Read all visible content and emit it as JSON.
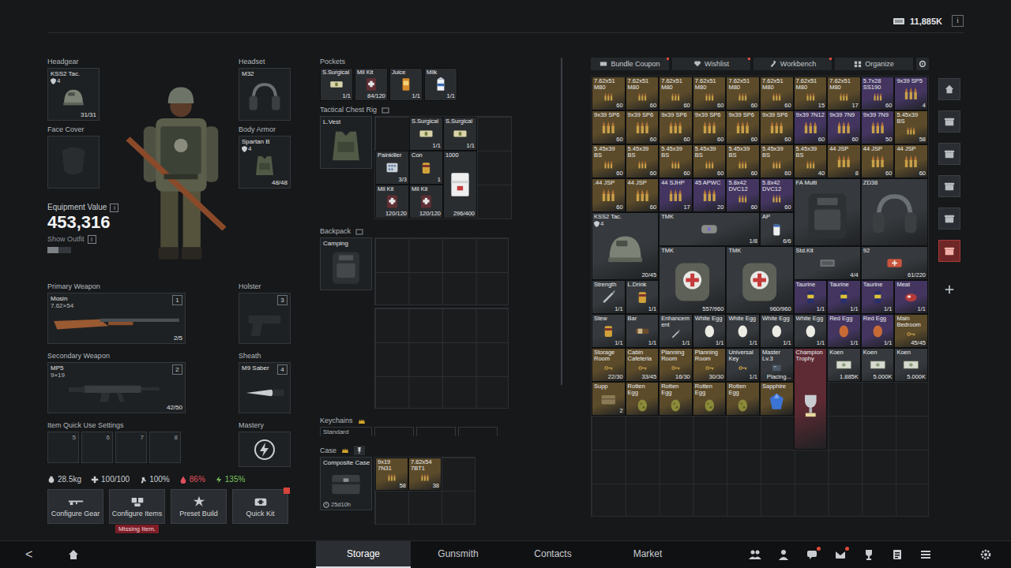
{
  "topbar": {
    "currency": "11,885K",
    "info": "i"
  },
  "loadout": {
    "headgear": {
      "label": "Headgear",
      "item": "KSS2 Tac.",
      "tier": "4",
      "durability": "31/31"
    },
    "face_cover": {
      "label": "Face Cover"
    },
    "headset": {
      "label": "Headset",
      "item": "M32"
    },
    "body_armor": {
      "label": "Body Armor",
      "item": "Spartan B",
      "tier": "4",
      "durability": "48/48"
    },
    "equipment_value": {
      "label": "Equipment Value",
      "info": "i",
      "value": "453,316"
    },
    "show_outfit": {
      "label": "Show Outfit",
      "info": "i",
      "on": false
    },
    "primary": {
      "label": "Primary Weapon",
      "item": "Mosin",
      "caliber": "7.62×54",
      "ammo": "2/5",
      "key": "1"
    },
    "holster": {
      "label": "Holster",
      "key": "3"
    },
    "secondary": {
      "label": "Secondary Weapon",
      "item": "MP5",
      "caliber": "9×19",
      "ammo": "42/50",
      "key": "2"
    },
    "sheath": {
      "label": "Sheath",
      "item": "M9 Saber",
      "key": "4"
    },
    "quick_use": {
      "label": "Item Quick Use Settings",
      "keys": [
        "5",
        "6",
        "7",
        "8"
      ]
    },
    "mastery": {
      "label": "Mastery"
    }
  },
  "stats": [
    {
      "kind": "weight",
      "value": "28.5kg",
      "color": "#c9cdd1"
    },
    {
      "kind": "health",
      "value": "100/100",
      "color": "#c9cdd1"
    },
    {
      "kind": "stamina",
      "value": "100%",
      "color": "#c9cdd1"
    },
    {
      "kind": "hydration",
      "value": "86%",
      "color": "#e0505a"
    },
    {
      "kind": "energy",
      "value": "135%",
      "color": "#7cc45a"
    }
  ],
  "actions": [
    {
      "label": "Configure Gear",
      "kind": "rifle",
      "alert": false
    },
    {
      "label": "Configure Items",
      "kind": "items",
      "alert": false,
      "warning": "Missing Item."
    },
    {
      "label": "Preset Build",
      "kind": "preset",
      "alert": false
    },
    {
      "label": "Quick Kit",
      "kind": "kit",
      "alert": true
    }
  ],
  "gear": {
    "pockets": {
      "label": "Pockets",
      "items": [
        {
          "name": "S.Surgical",
          "count": "1/1",
          "kind": "surgical"
        },
        {
          "name": "Mil Kit",
          "count": "84/120",
          "kind": "milkit"
        },
        {
          "name": "Juice",
          "count": "1/1",
          "kind": "juice"
        },
        {
          "name": "Milk",
          "count": "1/1",
          "kind": "milk"
        }
      ]
    },
    "rig": {
      "label": "Tactical Chest Rig",
      "container": "L.Vest",
      "items": [
        {
          "name": "S.Surgical",
          "count": "1/1",
          "kind": "surgical"
        },
        {
          "name": "S.Surgical",
          "count": "1/1",
          "kind": "surgical"
        },
        {
          "name": "Painkiller",
          "count": "3/3",
          "kind": "painkiller"
        },
        {
          "name": "Con",
          "count": "1",
          "kind": "can"
        },
        {
          "name": "1000",
          "count": "296/400",
          "kind": "roll"
        },
        {
          "name": "Mil Kit",
          "count": "120/120",
          "kind": "milkit"
        },
        {
          "name": "Mil Kit",
          "count": "120/120",
          "kind": "milkit"
        }
      ]
    },
    "backpack": {
      "label": "Backpack",
      "container": "Camping"
    },
    "keychains": {
      "label": "Keychains",
      "container": "Standard"
    },
    "case": {
      "label": "Case",
      "container": "Composite Case",
      "timer": "25d10h",
      "items": [
        {
          "name": "9x19 7N31",
          "count": "58",
          "kind": "ammo"
        },
        {
          "name": "7.62x54 7BT1",
          "count": "38",
          "kind": "ammo"
        }
      ]
    }
  },
  "storage": {
    "tabs": [
      {
        "label": "Bundle Coupon",
        "kind": "coupon",
        "alert": true
      },
      {
        "label": "Wishlist",
        "kind": "heart",
        "alert": true
      },
      {
        "label": "Workbench",
        "kind": "wrench",
        "alert": true
      },
      {
        "label": "Organize",
        "kind": "organize",
        "alert": false
      }
    ],
    "items": [
      {
        "name": "7.62x51 M80",
        "count": "60",
        "kind": "ammo",
        "color": "#5c4b2a"
      },
      {
        "name": "7.62x51 M80",
        "count": "60",
        "kind": "ammo",
        "color": "#5c4b2a"
      },
      {
        "name": "7.62x51 M80",
        "count": "60",
        "kind": "ammo",
        "color": "#5c4b2a"
      },
      {
        "name": "7.62x51 M80",
        "count": "60",
        "kind": "ammo",
        "color": "#5c4b2a"
      },
      {
        "name": "7.62x51 M80",
        "count": "60",
        "kind": "ammo",
        "color": "#5c4b2a"
      },
      {
        "name": "7.62x51 M80",
        "count": "60",
        "kind": "ammo",
        "color": "#5c4b2a"
      },
      {
        "name": "7.62x51 M80",
        "count": "15",
        "kind": "ammo",
        "color": "#5c4b2a"
      },
      {
        "name": "7.62x51 M80",
        "count": "17",
        "kind": "ammo",
        "color": "#5c4b2a"
      },
      {
        "name": "5.7x28 SS190",
        "count": "60",
        "kind": "ammo",
        "color": "#433560"
      },
      {
        "name": "9x39 SP5",
        "count": "4",
        "kind": "ammo",
        "color": "#433560"
      },
      {
        "name": "9x39 SP6",
        "count": "60",
        "kind": "ammo",
        "color": "#5c4b2a"
      },
      {
        "name": "9x39 SP6",
        "count": "60",
        "kind": "ammo",
        "color": "#5c4b2a"
      },
      {
        "name": "9x39 SP6",
        "count": "60",
        "kind": "ammo",
        "color": "#5c4b2a"
      },
      {
        "name": "9x39 SP6",
        "count": "60",
        "kind": "ammo",
        "color": "#5c4b2a"
      },
      {
        "name": "9x39 SP6",
        "count": "60",
        "kind": "ammo",
        "color": "#5c4b2a"
      },
      {
        "name": "9x39 SP6",
        "count": "60",
        "kind": "ammo",
        "color": "#5c4b2a"
      },
      {
        "name": "9x39 7N12",
        "count": "60",
        "kind": "ammo",
        "color": "#433560"
      },
      {
        "name": "9x39 7N9",
        "count": "60",
        "kind": "ammo",
        "color": "#433560"
      },
      {
        "name": "9x39 7N9",
        "count": "50",
        "kind": "ammo",
        "color": "#433560"
      },
      {
        "name": "5.45x39 BS",
        "count": "58",
        "kind": "ammo",
        "color": "#5c4b2a"
      },
      {
        "name": "5.45x39 BS",
        "count": "60",
        "kind": "ammo",
        "color": "#5c4b2a"
      },
      {
        "name": "5.45x39 BS",
        "count": "60",
        "kind": "ammo",
        "color": "#5c4b2a"
      },
      {
        "name": "5.45x39 BS",
        "count": "60",
        "kind": "ammo",
        "color": "#5c4b2a"
      },
      {
        "name": "5.45x39 BS",
        "count": "60",
        "kind": "ammo",
        "color": "#5c4b2a"
      },
      {
        "name": "5.45x39 BS",
        "count": "60",
        "kind": "ammo",
        "color": "#5c4b2a"
      },
      {
        "name": "5.45x39 BS",
        "count": "60",
        "kind": "ammo",
        "color": "#5c4b2a"
      },
      {
        "name": "5.45x39 BS",
        "count": "40",
        "kind": "ammo",
        "color": "#5c4b2a"
      },
      {
        "name": "44 JSP",
        "count": "8",
        "kind": "ammo",
        "color": "#5c4b2a"
      },
      {
        "name": "44 JSP",
        "count": "60",
        "kind": "ammo",
        "color": "#5c4b2a"
      },
      {
        "name": "44 JSP",
        "count": "60",
        "kind": "ammo",
        "color": "#5c4b2a"
      },
      {
        "name": ".44 JSP",
        "count": "60",
        "kind": "ammo",
        "color": "#5c4b2a"
      },
      {
        "name": "44 JSP",
        "count": "60",
        "kind": "ammo",
        "color": "#5c4b2a"
      },
      {
        "name": "44 SJHP",
        "count": "17",
        "kind": "ammo",
        "color": "#433560"
      },
      {
        "name": "45 APWC",
        "count": "20",
        "kind": "ammo",
        "color": "#433560"
      },
      {
        "name": "5.8x42 DVC12",
        "count": "60",
        "kind": "ammo",
        "color": "#433560"
      },
      {
        "name": "5.8x42 DVC12",
        "count": "60",
        "kind": "ammo",
        "color": "#433560"
      },
      {
        "name": "FA Multi",
        "kind": "bag",
        "color": "#363a3e"
      },
      {
        "name": "ZD38",
        "kind": "headset",
        "color": "#363a3e"
      },
      {
        "name": "KSS2 Tac.",
        "tier": "4",
        "count": "20/45",
        "kind": "helmet",
        "color": "#363a3e"
      },
      {
        "name": "TMK",
        "count": "1/8",
        "kind": "case",
        "color": "#363a3e"
      },
      {
        "name": "AP",
        "count": "6/6",
        "kind": "pills",
        "color": "#363a3e"
      },
      {
        "name": "TMK",
        "count": "557/960",
        "kind": "medkit",
        "color": "#363a3e"
      },
      {
        "name": "TMK",
        "count": "960/960",
        "kind": "medkit",
        "color": "#363a3e"
      },
      {
        "name": "Std.Kit",
        "count": "4/4",
        "kind": "kit",
        "color": "#363a3e"
      },
      {
        "name": "92",
        "count": "61/220",
        "kind": "pouch",
        "color": "#363a3e"
      },
      {
        "name": "Strength",
        "count": "1/1",
        "kind": "syringe",
        "color": "#363a3e"
      },
      {
        "name": "L.Drink",
        "count": "1/1",
        "kind": "can",
        "color": "#363a3e"
      },
      {
        "name": "Taurine",
        "count": "1/1",
        "kind": "drink",
        "color": "#433560"
      },
      {
        "name": "Taurine",
        "count": "1/1",
        "kind": "drink",
        "color": "#433560"
      },
      {
        "name": "Taurine",
        "count": "1/1",
        "kind": "drink",
        "color": "#433560"
      },
      {
        "name": "Meat",
        "count": "1/1",
        "kind": "meat",
        "color": "#433560"
      },
      {
        "name": "Stew",
        "count": "1/1",
        "kind": "can",
        "color": "#363a3e"
      },
      {
        "name": "Bar",
        "count": "1/1",
        "kind": "bar",
        "color": "#363a3e"
      },
      {
        "name": "Enhancement",
        "count": "1/1",
        "kind": "syringe",
        "color": "#363a3e"
      },
      {
        "name": "White Egg",
        "count": "1/1",
        "kind": "eggwhite",
        "color": "#363a3e"
      },
      {
        "name": "White Egg",
        "count": "1/1",
        "kind": "eggwhite",
        "color": "#363a3e"
      },
      {
        "name": "White Egg",
        "count": "1/1",
        "kind": "eggwhite",
        "color": "#363a3e"
      },
      {
        "name": "White Egg",
        "count": "1/1",
        "kind": "eggwhite",
        "color": "#363a3e"
      },
      {
        "name": "Red Egg",
        "count": "1/1",
        "kind": "eggred",
        "color": "#433560"
      },
      {
        "name": "Red Egg",
        "count": "1/1",
        "kind": "eggred",
        "color": "#433560"
      },
      {
        "name": "Main Bedroom",
        "count": "45/45",
        "kind": "key",
        "color": "#5c4b2a"
      },
      {
        "name": "Storage Room",
        "count": "22/30",
        "kind": "key",
        "color": "#5c4b2a"
      },
      {
        "name": "Cabin Cafeteria",
        "count": "33/45",
        "kind": "key",
        "color": "#5c4b2a"
      },
      {
        "name": "Planning Room",
        "count": "16/30",
        "kind": "key",
        "color": "#5c4b2a"
      },
      {
        "name": "Planning Room",
        "count": "30/30",
        "kind": "key",
        "color": "#5c4b2a"
      },
      {
        "name": "Universal Key",
        "count": "1/1",
        "kind": "key",
        "color": "#363a3e"
      },
      {
        "name": "Master Lv.3",
        "count": "Placing...",
        "kind": "card",
        "color": "#363a3e"
      },
      {
        "name": "Champion Trophy",
        "kind": "trophy",
        "color": "#5e2a33"
      },
      {
        "name": "Koen",
        "count": "1.885K",
        "kind": "cash",
        "color": "#363a3e"
      },
      {
        "name": "Koen",
        "count": "5.000K",
        "kind": "cash",
        "color": "#363a3e"
      },
      {
        "name": "Koen",
        "count": "5.000K",
        "kind": "cash",
        "color": "#363a3e"
      },
      {
        "name": "Supp",
        "count": "2",
        "kind": "crate",
        "color": "#5c4b2a"
      },
      {
        "name": "Rotten Egg",
        "kind": "eggrotten",
        "color": "#5c4b2a"
      },
      {
        "name": "Rotten Egg",
        "kind": "eggrotten",
        "color": "#5c4b2a"
      },
      {
        "name": "Rotten Egg",
        "kind": "eggrotten",
        "color": "#5c4b2a"
      },
      {
        "name": "Rotten Egg",
        "kind": "eggrotten",
        "color": "#5c4b2a"
      },
      {
        "name": "Sapphire",
        "kind": "gem",
        "color": "#5c4b2a"
      }
    ]
  },
  "sidebar": [
    {
      "kind": "home",
      "selected": false
    },
    {
      "kind": "box",
      "selected": false
    },
    {
      "kind": "box",
      "selected": false
    },
    {
      "kind": "box",
      "selected": false
    },
    {
      "kind": "box",
      "selected": false
    },
    {
      "kind": "box",
      "selected": true
    },
    {
      "kind": "plus",
      "selected": false
    }
  ],
  "nav": {
    "back": "<",
    "tabs": [
      {
        "label": "Storage",
        "selected": true
      },
      {
        "label": "Gunsmith",
        "selected": false
      },
      {
        "label": "Contacts",
        "selected": false
      },
      {
        "label": "Market",
        "selected": false
      }
    ],
    "icons": [
      {
        "kind": "friends",
        "alert": false
      },
      {
        "kind": "profile",
        "alert": false
      },
      {
        "kind": "chat",
        "alert": true
      },
      {
        "kind": "mail",
        "alert": true
      },
      {
        "kind": "rank",
        "alert": false
      },
      {
        "kind": "tasks",
        "alert": false
      },
      {
        "kind": "menu",
        "alert": false
      }
    ]
  }
}
